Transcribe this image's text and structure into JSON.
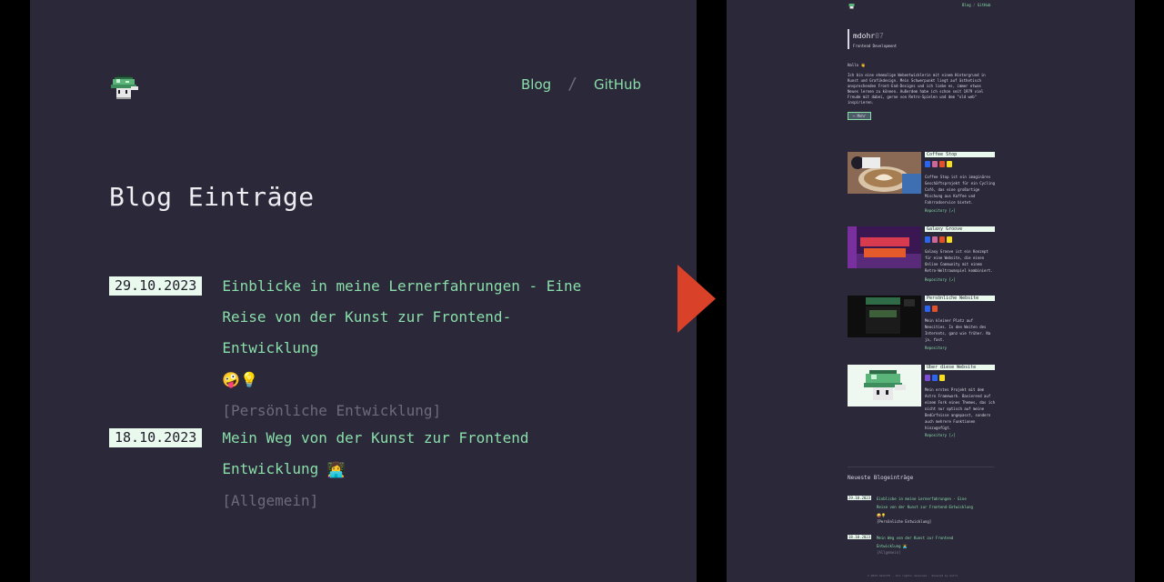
{
  "site": {
    "logo_icon": "pixel-mushroom-icon"
  },
  "nav": {
    "blog": "Blog",
    "separator": "/",
    "github": "GitHub"
  },
  "page": {
    "title": "Blog Einträge"
  },
  "posts": [
    {
      "date": "29.10.2023",
      "title": "Einblicke in meine Lernerfahrungen - Eine Reise von der Kunst zur Frontend-Entwicklung",
      "emojis": "🤪💡",
      "tag": "[Persönliche Entwicklung]"
    },
    {
      "date": "18.10.2023",
      "title": "Mein Weg von der Kunst zur Frontend Entwicklung",
      "emojis": "👩‍💻",
      "tag": "[Allgemein]"
    }
  ],
  "overview": {
    "nav": {
      "blog": "Blog",
      "separator": "/",
      "github": "GitHub"
    },
    "profile": {
      "name": "mdohr",
      "name_suffix": "07",
      "role": "Frontend Development"
    },
    "intro": {
      "greeting": "Hallo 👋",
      "text": "Ich bin eine ehemalige Webentwicklerin mit einem Hintergrund in Kunst und Grafikdesign. Mein Schwerpunkt liegt auf ästhetisch ansprechenden Front-End-Designs und ich liebe es, immer etwas Neues lernen zu können. Außerdem habe ich schon seit 1979 viel Freude mit dabei, gerne von Retro-Spielen und dem \"old web\" inspirieren.",
      "button": "→ Mehr"
    },
    "projects": [
      {
        "title": "Coffee Stop",
        "desc": "Coffee Stop ist ein imaginäres Geschäftsprojekt für ein Cycling Café, das eine großartige Mischung aus Kaffee und Fahrradservice bietet.",
        "link": "Repository [↗]"
      },
      {
        "title": "Galaxy Groove",
        "desc": "Galaxy Groove ist ein Konzept für eine Website, die einen Online Community mit einem Retro-Weltraumspiel kombiniert.",
        "link": "Repository [↗]"
      },
      {
        "title": "Persönliche Website",
        "desc": "Mein kleiner Platz auf Neocities. In den Weiten des Internets, ganz wie früher. Na ja, fast.",
        "link": "Repository"
      },
      {
        "title": "Über diese Website",
        "desc": "Mein erstes Projekt mit dem Astro Framework. Basierend auf einem Fork eines Themes, das ich nicht nur optisch auf meine Bedürfnisse angepasst, sondern auch mehrere Funktionen hinzugefügt.",
        "link": "Repository [↗]"
      }
    ],
    "recent_heading": "Neueste Blogeinträge",
    "recent": [
      {
        "date": "29.10.2023",
        "title": "Einblicke in meine Lernerfahrungen - Eine Reise von der Kunst zur Frontend-Entwicklung",
        "emojis": "🤪💡",
        "tag": "[Persönliche Entwicklung]"
      },
      {
        "date": "18.10.2023",
        "title": "Mein Weg von der Kunst zur Frontend Entwicklung",
        "emojis": "👩‍💻",
        "tag": "[Allgemein]"
      }
    ],
    "footer": "© 2023 mdohr07 · All rights reserved · Powered by Astro"
  },
  "colors": {
    "background": "#2b2839",
    "accent": "#89dfa9",
    "muted": "#6c6b7d",
    "date_bg": "#e9f9ee",
    "arrow": "#d94128"
  }
}
